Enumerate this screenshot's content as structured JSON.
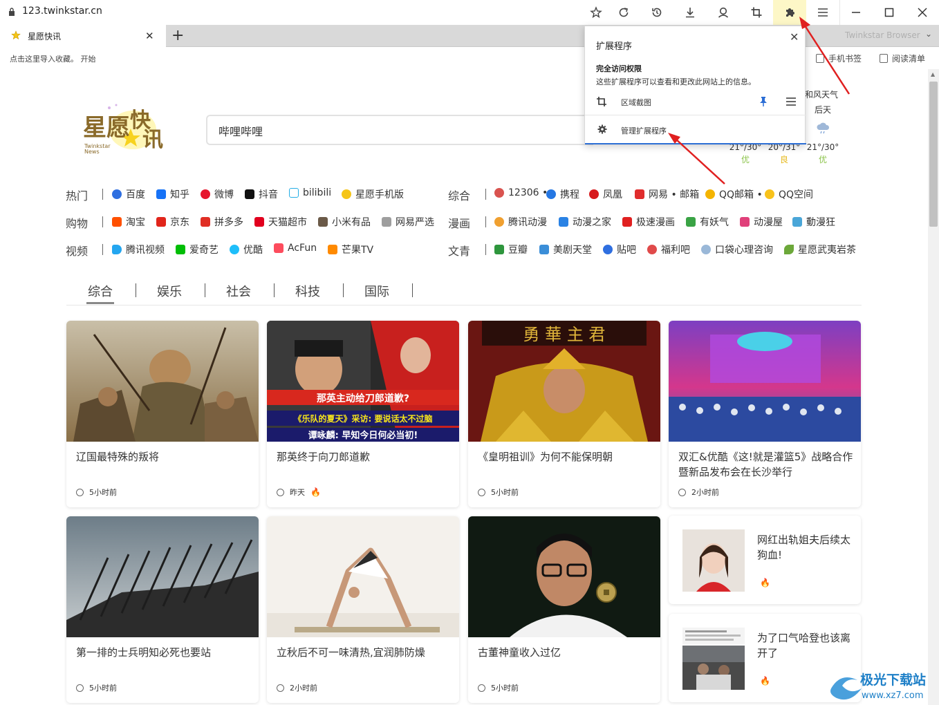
{
  "browser": {
    "url": "123.twinkstar.cn",
    "tab_title": "星愿快讯",
    "brand": "Twinkstar Browser",
    "bookmark_hint": "点击这里导入收藏。 开始",
    "bookmark_phone": "手机书签",
    "bookmark_reading": "阅读清单"
  },
  "toolbar_icons": [
    "star-icon",
    "refresh-icon",
    "history-icon",
    "download-icon",
    "account-icon",
    "crop-icon",
    "extension-icon",
    "menu-icon",
    "minimize-icon",
    "maximize-icon",
    "close-icon"
  ],
  "extension_popup": {
    "title": "扩展程序",
    "access_heading": "完全访问权限",
    "access_desc": "这些扩展程序可以查看和更改此网站上的信息。",
    "extension_name": "区域截图",
    "manage_label": "管理扩展程序"
  },
  "search": {
    "value": "哔哩哔哩"
  },
  "weather": {
    "forecast": [
      {
        "day": "",
        "temp": "21°/30°",
        "quality": "优"
      },
      {
        "day": "",
        "temp": "20°/31°",
        "quality": "良"
      },
      {
        "day": "后天",
        "temp": "21°/30°",
        "quality": "优"
      }
    ],
    "partial_text": "和风天气",
    "quality_colors": {
      "优": "#8bc34a",
      "良": "#e6b91e"
    }
  },
  "nav": {
    "rows": [
      {
        "category": "热门",
        "items": [
          "百度",
          "知乎",
          "微博",
          "抖音",
          "bilibili",
          "星愿手机版"
        ]
      },
      {
        "category": "购物",
        "items": [
          "淘宝",
          "京东",
          "拼多多",
          "天猫超市",
          "小米有品",
          "网易严选"
        ]
      },
      {
        "category": "视频",
        "items": [
          "腾讯视频",
          "爱奇艺",
          "优酷",
          "AcFun",
          "芒果TV"
        ]
      }
    ],
    "rows_right": [
      {
        "category": "综合",
        "items": [
          "12306 •",
          "携程",
          "凤凰",
          "网易 • 邮箱",
          "QQ邮箱 •",
          "QQ空间"
        ]
      },
      {
        "category": "漫画",
        "items": [
          "腾讯动漫",
          "动漫之家",
          "极速漫画",
          "有妖气",
          "动漫屋",
          "動漫狂"
        ]
      },
      {
        "category": "文青",
        "items": [
          "豆瓣",
          "美剧天堂",
          "贴吧",
          "福利吧",
          "口袋心理咨询",
          "星愿武夷岩茶"
        ]
      }
    ]
  },
  "news_tabs": [
    "综合",
    "娱乐",
    "社会",
    "科技",
    "国际"
  ],
  "cards": [
    {
      "title": "辽国最特殊的叛将",
      "time": "5小时前",
      "hot": false
    },
    {
      "title": "那英终于向刀郎道歉",
      "time": "昨天",
      "hot": true,
      "img_text": [
        "那英主动给刀郎道歉?",
        "《乐队的夏天》采访: 要说话太不过脑",
        "谭咏麟: 早知今日何必当初!"
      ]
    },
    {
      "title": "《皇明祖训》为何不能保明朝",
      "time": "5小时前",
      "hot": false,
      "img_text": [
        "勇 華 主 君"
      ]
    },
    {
      "title": "双汇&优酷《这!就是灌篮5》战略合作暨新品发布会在长沙举行",
      "time": "2小时前",
      "hot": false
    },
    {
      "title": "第一排的士兵明知必死也要站",
      "time": "5小时前",
      "hot": false
    },
    {
      "title": "立秋后不可一味清热,宜润肺防燥",
      "time": "2小时前",
      "hot": false
    },
    {
      "title": "古董神童收入过亿",
      "time": "5小时前",
      "hot": false
    }
  ],
  "side_cards": [
    {
      "title": "网红出轨姐夫后续太狗血!",
      "hot": true
    },
    {
      "title": "为了口气哈登也该离开了",
      "hot": true
    }
  ],
  "watermark": {
    "text": "极光下载站",
    "url": "www.xz7.com"
  },
  "colors": {
    "accent": "#2c6ed5",
    "extension_highlight": "#fdf7c7",
    "fire": "#e8432e",
    "arrow": "#e02020"
  }
}
